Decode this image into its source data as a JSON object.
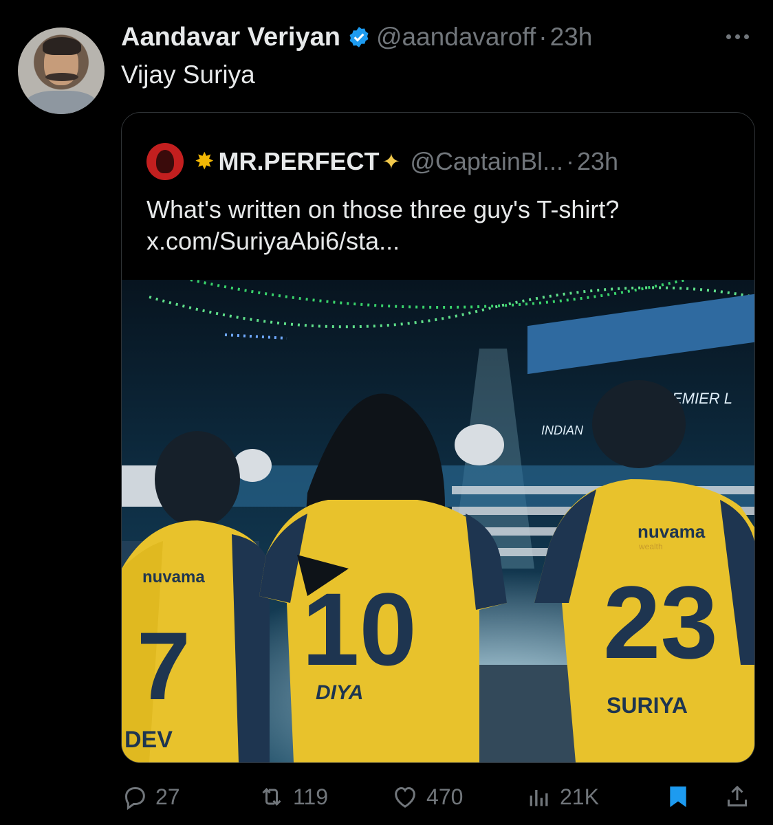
{
  "tweet": {
    "author_name": "Aandavar Veriyan",
    "author_handle": "@aandavaroff",
    "separator": "·",
    "time": "23h",
    "text": "Vijay Suriya"
  },
  "quoted": {
    "author_name": "MR.PERFECT",
    "author_handle": "@CaptainBl...",
    "separator": "·",
    "time": "23h",
    "text": "What's written on those three guy's T-shirt?",
    "link": "x.com/SuriyaAbi6/sta...",
    "image": {
      "jerseys": [
        {
          "number": "7",
          "name": "DEV",
          "sponsor": "nuvama"
        },
        {
          "number": "10",
          "name": "DIYA"
        },
        {
          "number": "23",
          "name": "SURIYA",
          "sponsor": "nuvama",
          "sponsor_sub": "wealth"
        }
      ],
      "banners": [
        "INDIAN",
        "EMIER L"
      ]
    }
  },
  "actions": {
    "replies": "27",
    "reposts": "119",
    "likes": "470",
    "views": "21K"
  },
  "colors": {
    "background": "#000000",
    "text": "#e7e9ea",
    "muted": "#71767b",
    "verified": "#1d9bf0",
    "bookmark": "#1d9bf0",
    "jersey_yellow": "#e8c22c",
    "jersey_navy": "#1e3550"
  }
}
